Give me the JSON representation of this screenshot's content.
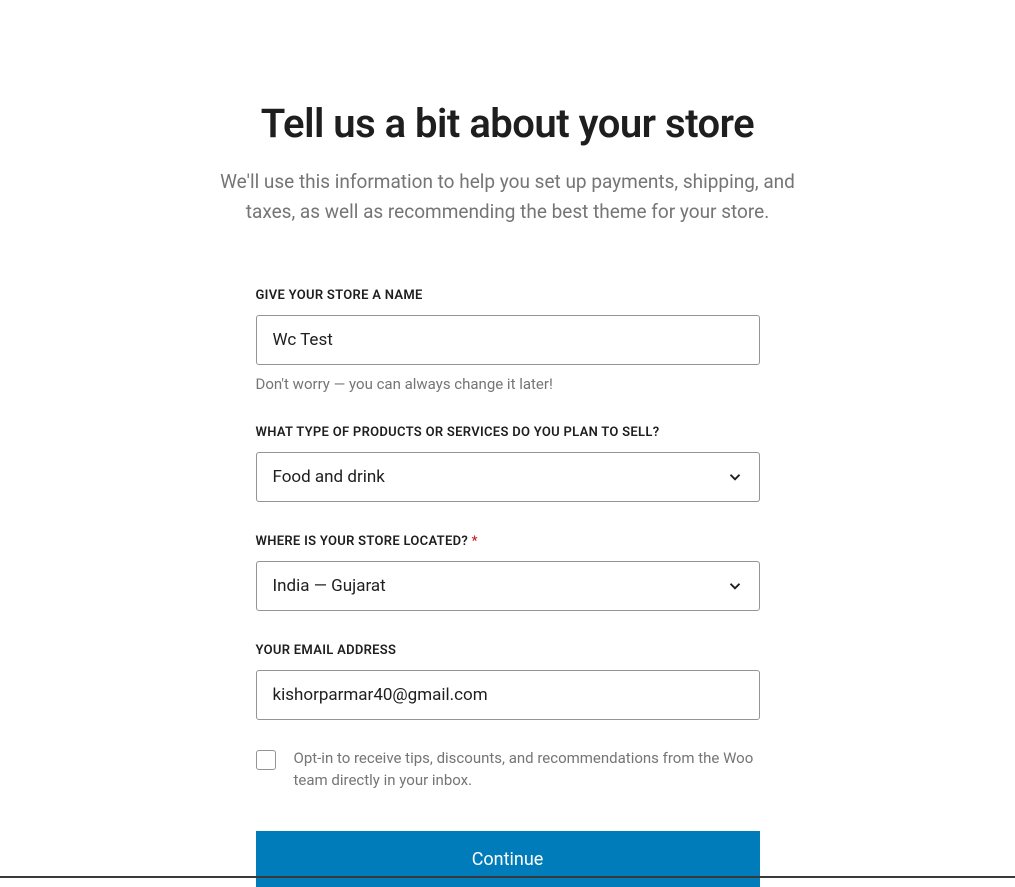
{
  "heading": "Tell us a bit about your store",
  "subheading": "We'll use this information to help you set up payments, shipping, and taxes, as well as recommending the best theme for your store.",
  "form": {
    "storeName": {
      "label": "GIVE YOUR STORE A NAME",
      "value": "Wc Test",
      "helper": "Don't worry — you can always change it later!"
    },
    "productType": {
      "label": "WHAT TYPE OF PRODUCTS OR SERVICES DO YOU PLAN TO SELL?",
      "value": "Food and drink"
    },
    "location": {
      "label": "WHERE IS YOUR STORE LOCATED?",
      "required": "*",
      "value": "India — Gujarat"
    },
    "email": {
      "label": "YOUR EMAIL ADDRESS",
      "value": "kishorparmar40@gmail.com"
    },
    "optIn": {
      "label": "Opt-in to receive tips, discounts, and recommendations from the Woo team directly in your inbox."
    },
    "continue": "Continue"
  }
}
